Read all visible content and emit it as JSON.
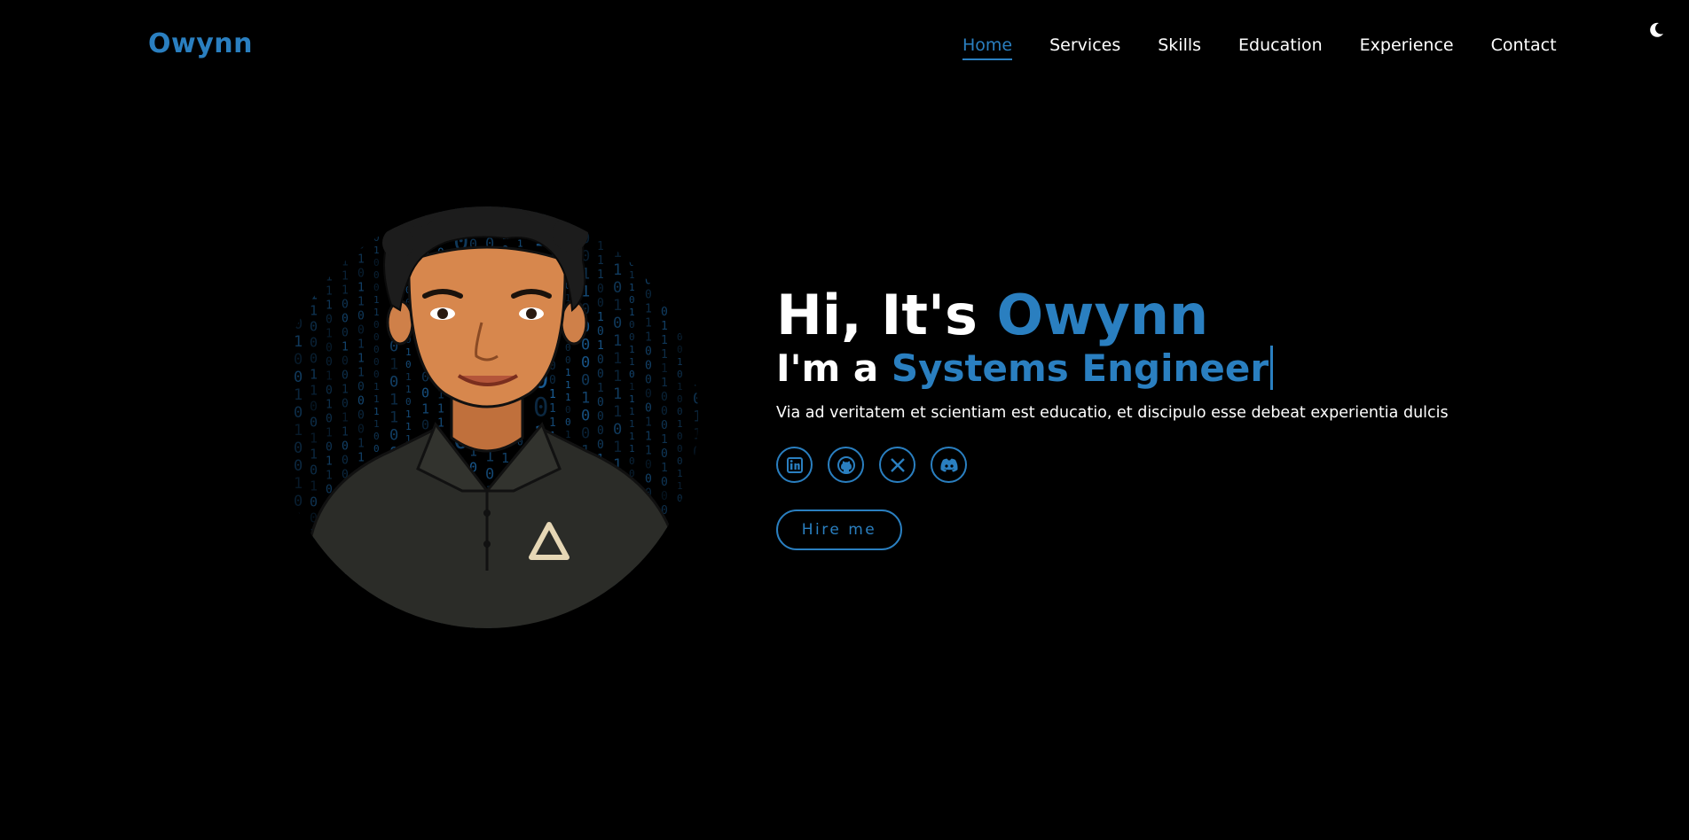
{
  "brand": {
    "name": "Owynn"
  },
  "nav": {
    "items": [
      {
        "label": "Home"
      },
      {
        "label": "Services"
      },
      {
        "label": "Skills"
      },
      {
        "label": "Education"
      },
      {
        "label": "Experience"
      },
      {
        "label": "Contact"
      }
    ],
    "active": "Home"
  },
  "theme_toggle": {
    "icon": "moon-icon"
  },
  "hero": {
    "greeting_prefix": "Hi, It's ",
    "name": "Owynn",
    "role_prefix": "I'm a ",
    "role": "Systems Engineer",
    "description": "Via ad veritatem et scientiam est educatio, et discipulo esse debeat experientia dulcis",
    "socials": [
      {
        "icon": "linkedin-icon"
      },
      {
        "icon": "github-icon"
      },
      {
        "icon": "x-icon"
      },
      {
        "icon": "discord-icon"
      }
    ],
    "cta": "Hire me"
  },
  "colors": {
    "accent": "#2a7fc0",
    "background": "#000000",
    "text": "#ffffff"
  }
}
